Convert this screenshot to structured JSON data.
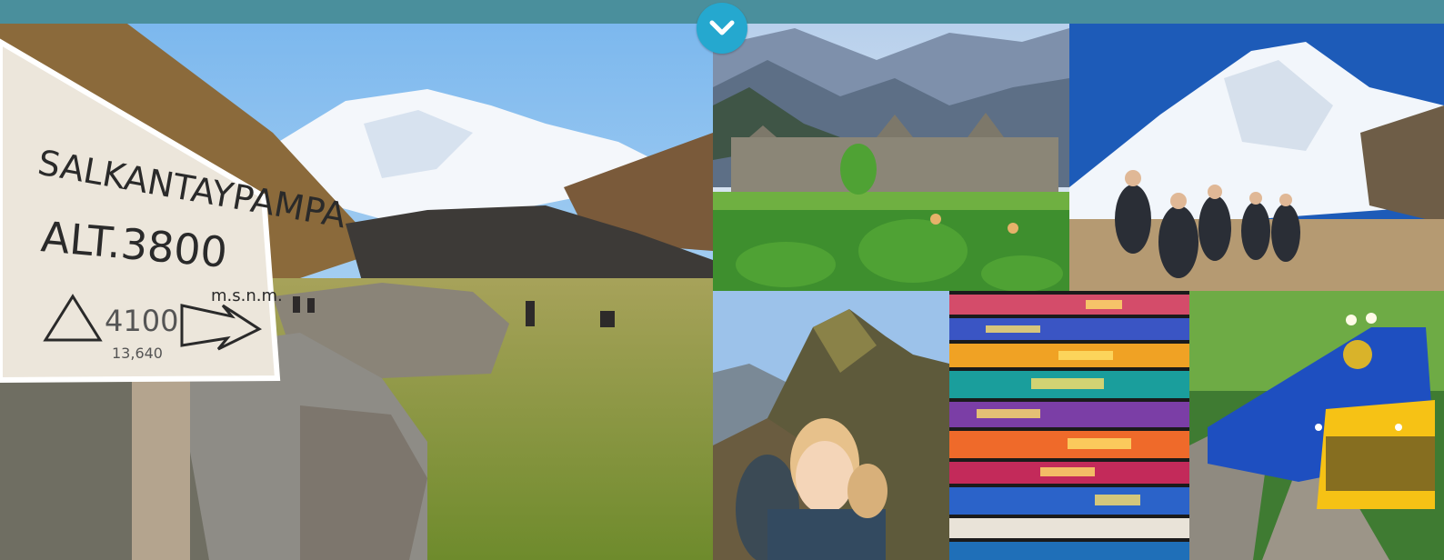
{
  "header": {
    "toggle_icon": "chevron-down-icon",
    "bar_color": "#4a8f9c",
    "toggle_color": "#25a8cf"
  },
  "gallery": {
    "sign": {
      "line1": "SALKANTAYPAMPA",
      "line2": "ALT.3800",
      "line2_unit": "m.s.n.m.",
      "line3": "4100",
      "line4": "13,640"
    }
  }
}
